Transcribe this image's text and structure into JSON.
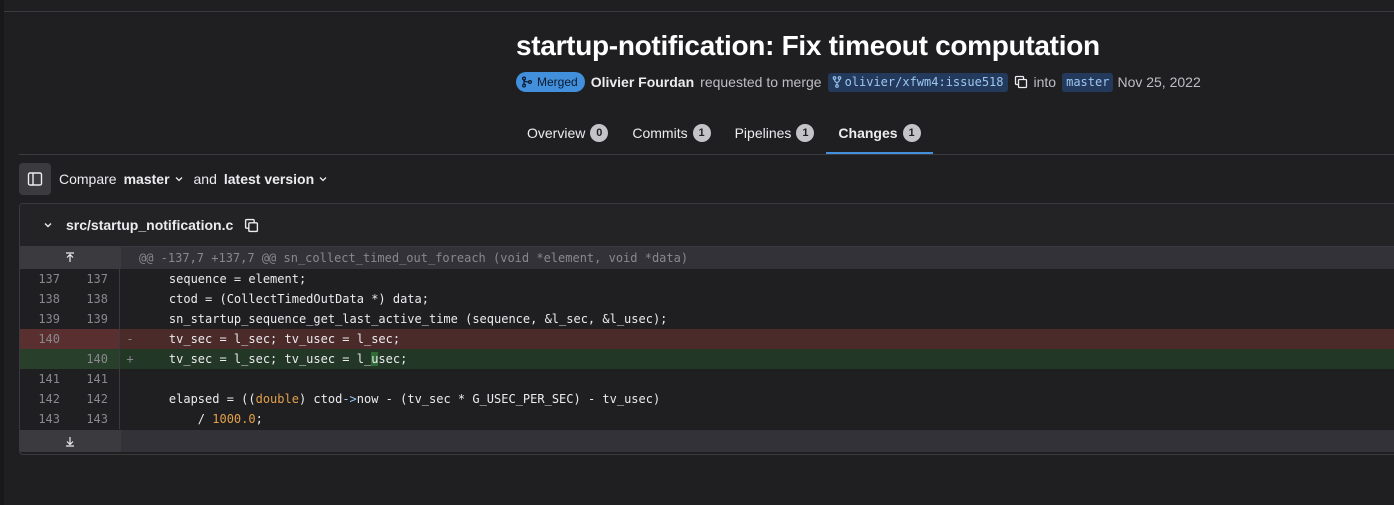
{
  "mr": {
    "title": "startup-notification: Fix timeout computation",
    "status": "Merged",
    "author": "Olivier Fourdan",
    "requested_text": "requested to merge",
    "source_branch": "olivier/xfwm4:issue518",
    "into_text": "into",
    "target_branch": "master",
    "date": "Nov 25, 2022"
  },
  "tabs": [
    {
      "label": "Overview",
      "count": "0"
    },
    {
      "label": "Commits",
      "count": "1"
    },
    {
      "label": "Pipelines",
      "count": "1"
    },
    {
      "label": "Changes",
      "count": "1"
    }
  ],
  "compare": {
    "label": "Compare",
    "base": "master",
    "and_text": "and",
    "head": "latest version"
  },
  "file": {
    "path": "src/startup_notification.c",
    "hunk_header": "@@ -137,7 +137,7 @@ sn_collect_timed_out_foreach (void *element, void *data)",
    "lines": [
      {
        "old": "137",
        "new": "137",
        "sign": "",
        "text": "    sequence = element;"
      },
      {
        "old": "138",
        "new": "138",
        "sign": "",
        "text": "    ctod = (CollectTimedOutData *) data;"
      },
      {
        "old": "139",
        "new": "139",
        "sign": "",
        "text": "    sn_startup_sequence_get_last_active_time (sequence, &l_sec, &l_usec);"
      },
      {
        "old": "140",
        "new": "",
        "sign": "-",
        "text": "    tv_sec = l_sec; tv_usec = l_sec;"
      },
      {
        "old": "",
        "new": "140",
        "sign": "+",
        "text": "    tv_sec = l_sec; tv_usec = l_usec;"
      },
      {
        "old": "141",
        "new": "141",
        "sign": "",
        "text": ""
      },
      {
        "old": "142",
        "new": "142",
        "sign": "",
        "text": "    elapsed = ((double) ctod->now - (tv_sec * G_USEC_PER_SEC) - tv_usec)"
      },
      {
        "old": "143",
        "new": "143",
        "sign": "",
        "text": "        / 1000.0;"
      }
    ]
  },
  "colors": {
    "accent": "#428fdc",
    "deleted_row": "#4b2a2a",
    "added_row": "#233726"
  }
}
